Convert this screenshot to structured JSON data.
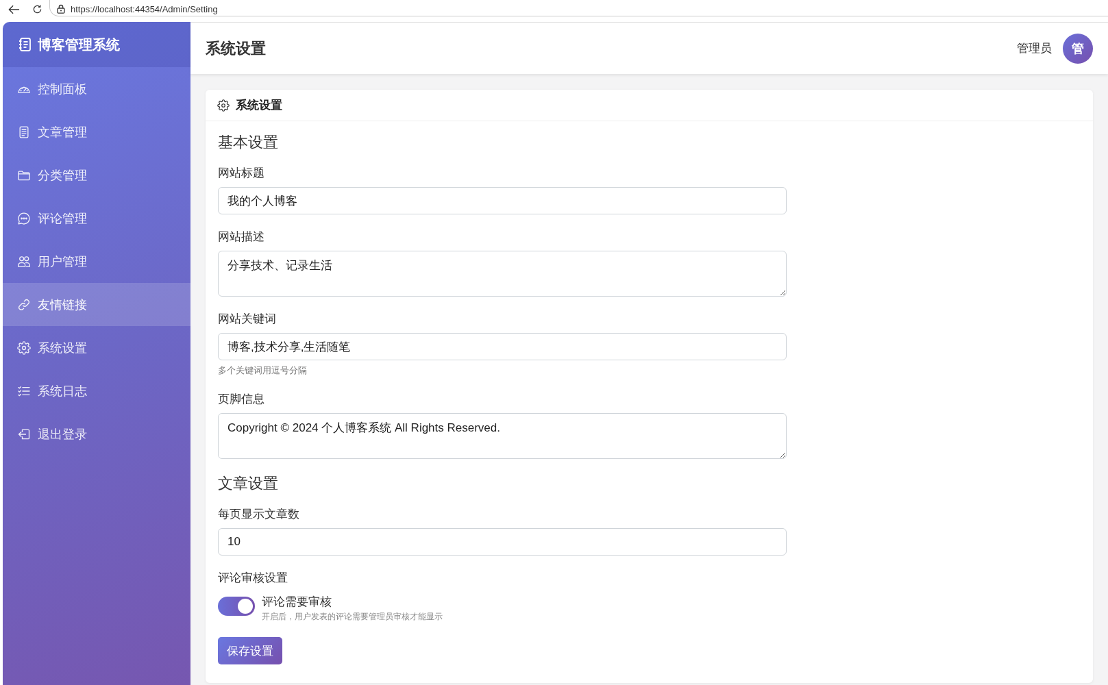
{
  "browser": {
    "url": "https://localhost:44354/Admin/Setting"
  },
  "sidebar": {
    "title": "博客管理系统",
    "items": [
      {
        "label": "控制面板",
        "selected": false
      },
      {
        "label": "文章管理",
        "selected": false
      },
      {
        "label": "分类管理",
        "selected": false
      },
      {
        "label": "评论管理",
        "selected": false
      },
      {
        "label": "用户管理",
        "selected": false
      },
      {
        "label": "友情链接",
        "selected": true
      },
      {
        "label": "系统设置",
        "selected": false
      },
      {
        "label": "系统日志",
        "selected": false
      },
      {
        "label": "退出登录",
        "selected": false
      }
    ]
  },
  "header": {
    "title": "系统设置",
    "user_name": "管理员",
    "avatar_text": "管"
  },
  "card": {
    "title": "系统设置",
    "sections": [
      {
        "heading": "基本设置",
        "fields": [
          {
            "kind": "input",
            "label": "网站标题",
            "value": "我的个人博客"
          },
          {
            "kind": "textarea",
            "label": "网站描述",
            "value": "分享技术、记录生活"
          },
          {
            "kind": "input",
            "label": "网站关键词",
            "value": "博客,技术分享,生活随笔",
            "help": "多个关键词用逗号分隔"
          },
          {
            "kind": "textarea",
            "label": "页脚信息",
            "value": "Copyright © 2024 个人博客系统 All Rights Reserved."
          }
        ]
      },
      {
        "heading": "文章设置",
        "fields": [
          {
            "kind": "input",
            "label": "每页显示文章数",
            "value": "10"
          },
          {
            "kind": "toggle",
            "label": "评论审核设置",
            "toggle_label": "评论需要审核",
            "description": "开启后，用户发表的评论需要管理员审核才能显示",
            "on": true
          }
        ]
      }
    ],
    "save_button": "保存设置"
  }
}
